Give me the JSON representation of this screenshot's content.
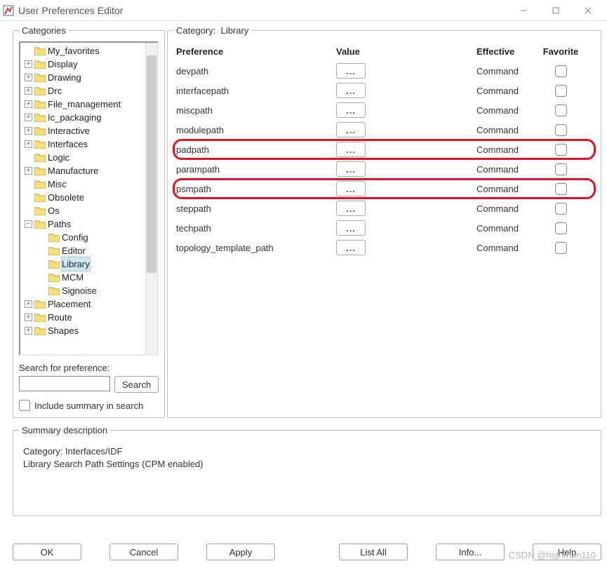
{
  "window": {
    "title": "User Preferences Editor"
  },
  "categories": {
    "legend": "Categories",
    "search_label": "Search for preference:",
    "search_button": "Search",
    "include_label": "Include summary in search",
    "tree": [
      {
        "level": 0,
        "exp": "none",
        "label": "My_favorites"
      },
      {
        "level": 0,
        "exp": "plus",
        "label": "Display"
      },
      {
        "level": 0,
        "exp": "plus",
        "label": "Drawing"
      },
      {
        "level": 0,
        "exp": "plus",
        "label": "Drc"
      },
      {
        "level": 0,
        "exp": "plus",
        "label": "File_management"
      },
      {
        "level": 0,
        "exp": "plus",
        "label": "Ic_packaging"
      },
      {
        "level": 0,
        "exp": "plus",
        "label": "Interactive"
      },
      {
        "level": 0,
        "exp": "plus",
        "label": "Interfaces"
      },
      {
        "level": 0,
        "exp": "none",
        "label": "Logic"
      },
      {
        "level": 0,
        "exp": "plus",
        "label": "Manufacture"
      },
      {
        "level": 0,
        "exp": "none",
        "label": "Misc"
      },
      {
        "level": 0,
        "exp": "none",
        "label": "Obsolete"
      },
      {
        "level": 0,
        "exp": "none",
        "label": "Os"
      },
      {
        "level": 0,
        "exp": "minus",
        "label": "Paths"
      },
      {
        "level": 1,
        "exp": "none",
        "label": "Config"
      },
      {
        "level": 1,
        "exp": "none",
        "label": "Editor"
      },
      {
        "level": 1,
        "exp": "none",
        "label": "Library",
        "selected": true
      },
      {
        "level": 1,
        "exp": "none",
        "label": "MCM"
      },
      {
        "level": 1,
        "exp": "none",
        "label": "Signoise"
      },
      {
        "level": 0,
        "exp": "plus",
        "label": "Placement"
      },
      {
        "level": 0,
        "exp": "plus",
        "label": "Route"
      },
      {
        "level": 0,
        "exp": "plus",
        "label": "Shapes",
        "partial": true
      }
    ]
  },
  "main": {
    "category_label": "Category:",
    "category_value": "Library",
    "headers": {
      "pref": "Preference",
      "val": "Value",
      "eff": "Effective",
      "fav": "Favorite"
    },
    "rows": [
      {
        "name": "devpath",
        "eff": "Command",
        "hl": false
      },
      {
        "name": "interfacepath",
        "eff": "Command",
        "hl": false
      },
      {
        "name": "miscpath",
        "eff": "Command",
        "hl": false
      },
      {
        "name": "modulepath",
        "eff": "Command",
        "hl": false
      },
      {
        "name": "padpath",
        "eff": "Command",
        "hl": true
      },
      {
        "name": "parampath",
        "eff": "Command",
        "hl": false
      },
      {
        "name": "psmpath",
        "eff": "Command",
        "hl": true
      },
      {
        "name": "steppath",
        "eff": "Command",
        "hl": false
      },
      {
        "name": "techpath",
        "eff": "Command",
        "hl": false
      },
      {
        "name": "topology_template_path",
        "eff": "Command",
        "hl": false
      }
    ]
  },
  "summary": {
    "legend": "Summary description",
    "line1": "Category: Interfaces/IDF",
    "line2": "Library Search Path Settings (CPM enabled)"
  },
  "buttons": {
    "ok": "OK",
    "cancel": "Cancel",
    "apply": "Apply",
    "listall": "List All",
    "info": "Info...",
    "help": "Help"
  },
  "watermark": "CSDN @highman110"
}
